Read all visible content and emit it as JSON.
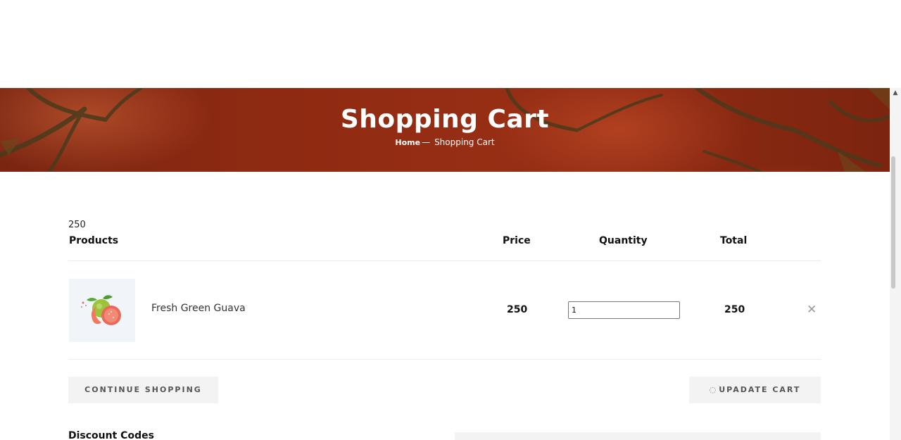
{
  "hero": {
    "title": "Shopping Cart",
    "breadcrumb": {
      "home": "Home",
      "separator": "—",
      "current": "Shopping Cart"
    }
  },
  "cart": {
    "stray_value": "250",
    "headers": {
      "products": "Products",
      "price": "Price",
      "quantity": "Quantity",
      "total": "Total"
    },
    "items": [
      {
        "name": "Fresh Green Guava",
        "price": "250",
        "quantity": "1",
        "total": "250",
        "image_icon": "guava-fruit-icon",
        "remove_icon": "close-icon"
      }
    ],
    "continue_label": "CONTINUE SHOPPING",
    "update_label": "UPADATE CART",
    "update_icon": "loading-icon"
  },
  "discount": {
    "title": "Discount Codes"
  },
  "colors": {
    "banner": "#8e2a12",
    "button_bg": "#f3f3f3",
    "thumb_bg": "#f1f4f9"
  }
}
